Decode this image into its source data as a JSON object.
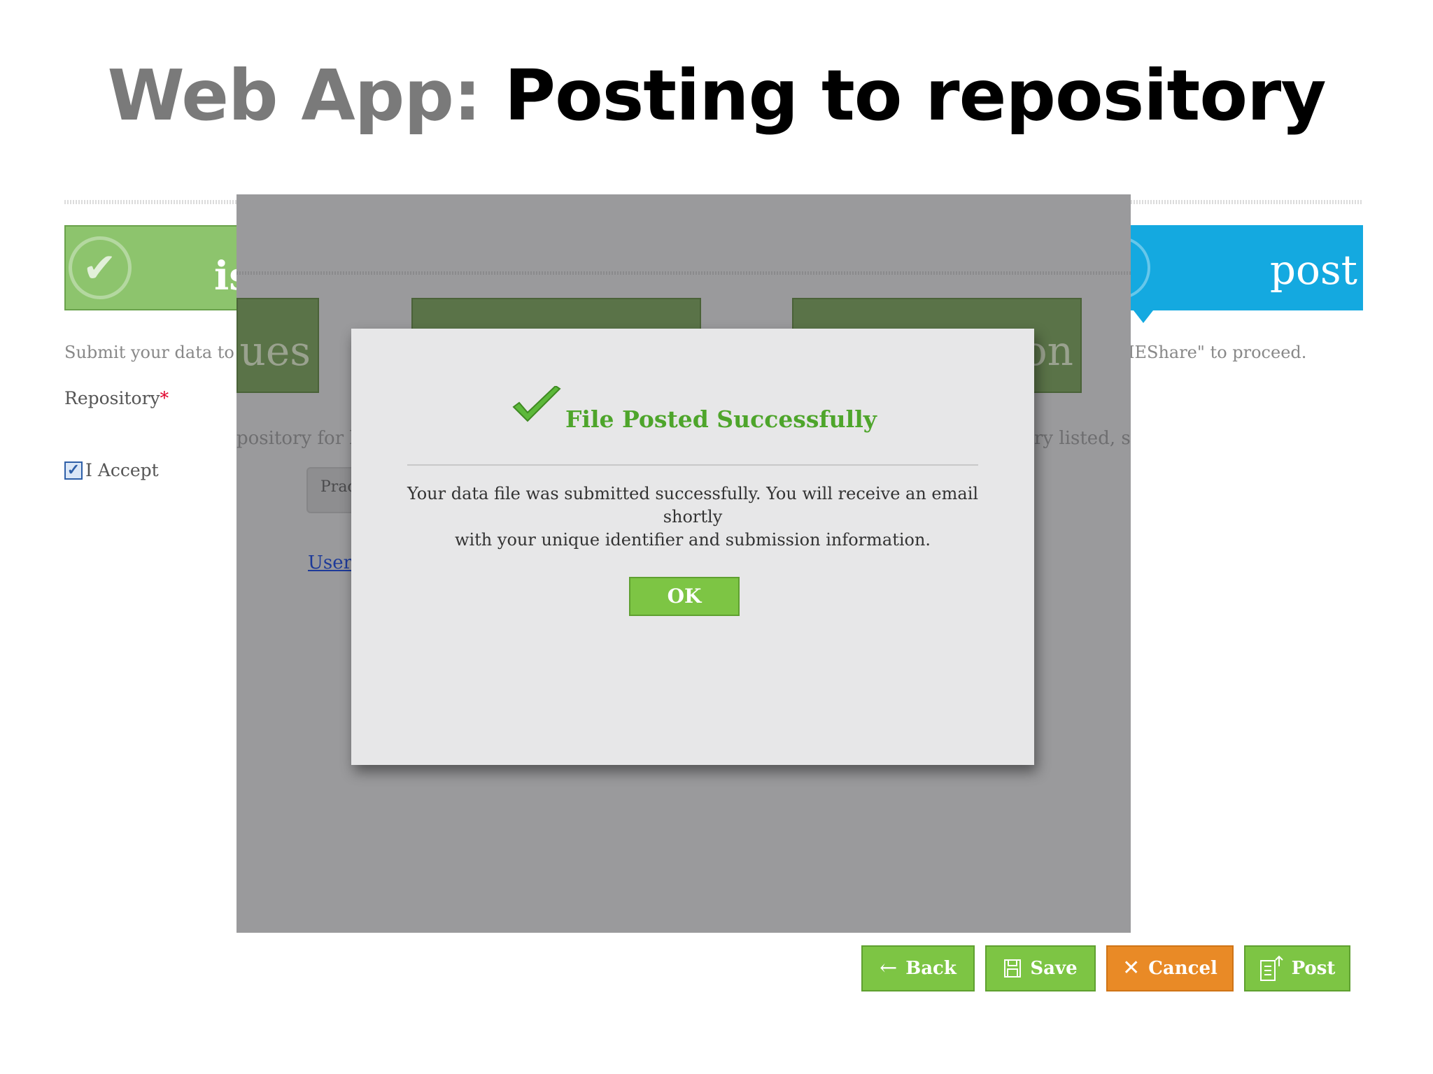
{
  "slide": {
    "title_prefix": "Web App:",
    "title_main": "Posting to repository"
  },
  "steps": {
    "left_banner_label": "is",
    "right_banner_label": "post"
  },
  "form": {
    "description_left": "Submit your data to a",
    "description_right": "IEShare\" to proceed.",
    "repository_label": "Repository",
    "required_marker": "*",
    "accept_label": "I Accept"
  },
  "background_dimmed": {
    "box1_text": "sues",
    "box3_text": "on",
    "text_left": "pository for lo",
    "text_right": "ry listed, se",
    "select_value": "Prac",
    "link_text": "User"
  },
  "dialog": {
    "title": "File Posted Successfully",
    "message_line1": "Your data file was submitted successfully. You will receive an email shortly",
    "message_line2": "with your unique identifier and submission information.",
    "ok_label": "OK"
  },
  "buttons": {
    "back": "Back",
    "save": "Save",
    "cancel": "Cancel",
    "post": "Post"
  },
  "colors": {
    "green": "#7dc544",
    "orange": "#e98a26",
    "blue": "#14a9e0",
    "title_green": "#4ea52b"
  }
}
